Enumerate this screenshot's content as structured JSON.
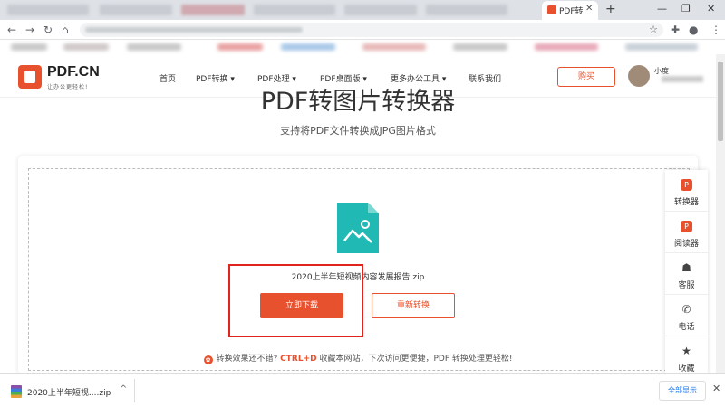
{
  "browser": {
    "active_tab_title": "PDF转图片转换器",
    "close_tab": "✕",
    "new_tab": "+",
    "window_controls": [
      "—",
      "❐",
      "✕"
    ],
    "nav": {
      "back": "←",
      "forward": "→",
      "reload": "↻",
      "home": "⌂"
    },
    "bookmark_star": "☆",
    "toolbar_icons": {
      "extensions": "✚",
      "profile": "●",
      "menu": "⋮"
    }
  },
  "site": {
    "brand": "PDF.CN",
    "tagline": "让办公更轻松!",
    "nav": [
      "首页",
      "PDF转换 ▾",
      "PDF处理 ▾",
      "PDF桌面版 ▾",
      "更多办公工具 ▾",
      "联系我们"
    ],
    "buy": "购买",
    "username": "小度"
  },
  "main": {
    "title": "PDF转图片转换器",
    "subtitle": "支持将PDF文件转换成JPG图片格式",
    "file_name": "2020上半年短视频内容发展报告.zip",
    "download": "立即下载",
    "reconvert": "重新转换",
    "tip_icon": "✿",
    "tip_pre": "转换效果还不错?",
    "tip_kbd": "CTRL+D",
    "tip_post": "收藏本网站，下次访问更便捷，PDF 转换处理更轻松!"
  },
  "sidebar": [
    {
      "label": "转换器",
      "icon": "converter-icon",
      "glyph": "P"
    },
    {
      "label": "阅读器",
      "icon": "reader-icon",
      "glyph": "P"
    },
    {
      "label": "客服",
      "icon": "customer-service-icon",
      "glyph": "☗"
    },
    {
      "label": "电话",
      "icon": "phone-icon",
      "glyph": "✆"
    },
    {
      "label": "收藏",
      "icon": "star-icon",
      "glyph": "★"
    }
  ],
  "downloadbar": {
    "item_name": "2020上半年短视....zip",
    "chevron": "^",
    "show_all": "全部显示",
    "close": "✕"
  },
  "colors": {
    "accent": "#e8512e",
    "file_icon": "#21b9b3",
    "highlight": "#e0231c"
  }
}
